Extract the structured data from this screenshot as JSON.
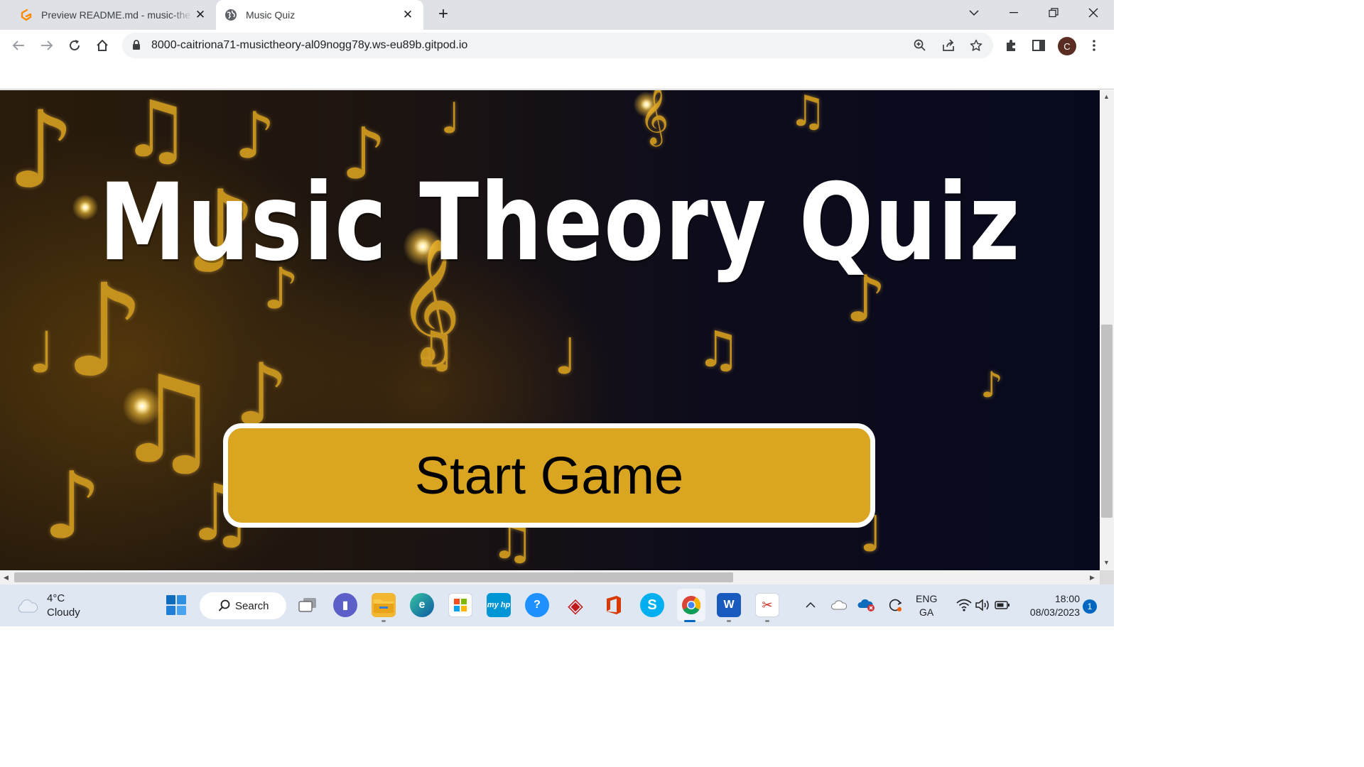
{
  "browser": {
    "tabs": [
      {
        "title": "Preview README.md - music-the",
        "active": false
      },
      {
        "title": "Music Quiz",
        "active": true
      }
    ],
    "new_tab_symbol": "+",
    "url": "8000-caitriona71-musictheory-al09nogg78y.ws-eu89b.gitpod.io",
    "profile_initial": "C"
  },
  "page": {
    "title": "Music Theory Quiz",
    "start_button": "Start Game",
    "background_color": "#0d0c1c",
    "accent_gold": "#daa520"
  },
  "taskbar": {
    "weather_temp": "4°C",
    "weather_desc": "Cloudy",
    "search_label": "Search",
    "lang_line1": "ENG",
    "lang_line2": "GA",
    "time": "18:00",
    "date": "08/03/2023",
    "notification_count": "1",
    "apps": [
      "start-icon",
      "task-view-icon",
      "teams-chat-icon",
      "file-explorer-icon",
      "edge-icon",
      "store-icon",
      "myhp-icon",
      "get-help-icon",
      "mcafee-icon",
      "office-icon",
      "skype-icon",
      "chrome-icon",
      "word-icon",
      "snipping-tool-icon"
    ]
  }
}
